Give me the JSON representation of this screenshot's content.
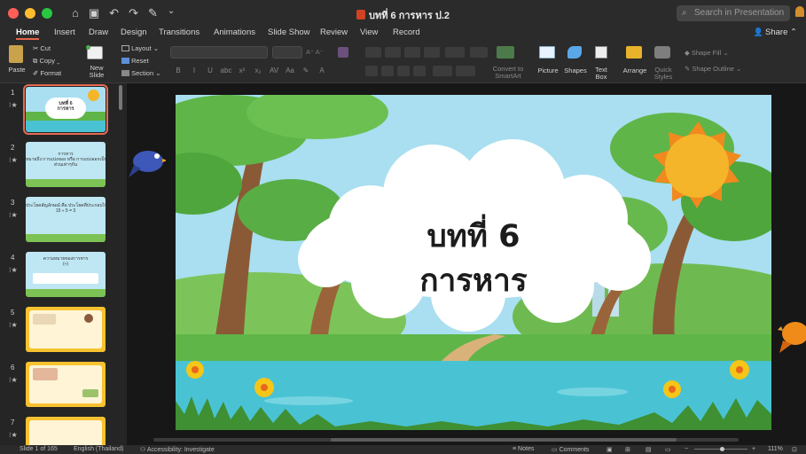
{
  "window": {
    "title": "บทที่ 6 การหาร ป.2",
    "search_placeholder": "Search in Presentation",
    "controls": {
      "close": "#ff5f57",
      "minimize": "#febc2e",
      "zoom": "#28c840"
    }
  },
  "quick_access": [
    "home-icon",
    "save-icon",
    "undo-icon",
    "redo-icon",
    "customize-icon"
  ],
  "tabs": [
    "Home",
    "Insert",
    "Draw",
    "Design",
    "Transitions",
    "Animations",
    "Slide Show",
    "Review",
    "View",
    "Record"
  ],
  "active_tab": "Home",
  "share_label": "Share",
  "ribbon": {
    "paste": "Paste",
    "cut": "Cut",
    "copy": "Copy",
    "format": "Format",
    "new_slide": "New\nSlide",
    "layout": "Layout",
    "reset": "Reset",
    "section": "Section",
    "convert_smartart": "Convert to\nSmartArt",
    "picture": "Picture",
    "shapes": "Shapes",
    "text_box": "Text\nBox",
    "arrange": "Arrange",
    "quick_styles": "Quick\nStyles",
    "shape_fill": "Shape Fill",
    "shape_outline": "Shape Outline"
  },
  "slides": [
    {
      "number": "1",
      "title": "บทที่ 6\nการหาร",
      "selected": true
    },
    {
      "number": "2",
      "title": "การหาร\nหมายถึง การแบ่งของ หรือ การแบ่งออกเป็น\nส่วนเท่าๆกัน"
    },
    {
      "number": "3",
      "title": "ประโยคสัญลักษณ์ คือ ประโยคที่ประกอบไปด้วย ตัวเลข\n15 ÷ 5 = 3"
    },
    {
      "number": "4",
      "title": "ความหมายของการหาร\n(÷)"
    },
    {
      "number": "5",
      "title": ""
    },
    {
      "number": "6",
      "title": ""
    },
    {
      "number": "7",
      "title": ""
    }
  ],
  "main_slide": {
    "line1": "บทที่ 6",
    "line2": "การหาร"
  },
  "status": {
    "slide_count": "Slide 1 of 165",
    "language": "English (Thailand)",
    "accessibility": "Accessibility: Investigate",
    "notes": "Notes",
    "comments": "Comments",
    "zoom": "111%"
  },
  "colors": {
    "accent": "#e2664a",
    "sky": "#a9dff0",
    "grass": "#5fb548",
    "water": "#49c3d4"
  }
}
